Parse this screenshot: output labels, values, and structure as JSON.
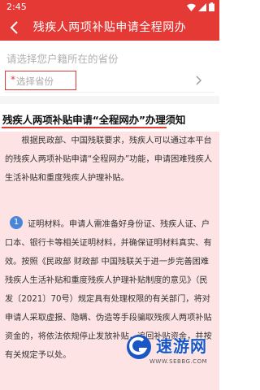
{
  "status": {
    "time": "2:45"
  },
  "header": {
    "title": "残疾人两项补贴申请全程网办"
  },
  "form": {
    "hint": "请选择您户籍所在的省份",
    "required_mark": "*",
    "province_placeholder": "选择省份"
  },
  "notice": {
    "title": "残疾人两项补贴申请“全程网办”办理须知",
    "intro": "根据民政部、中国残联要求，残疾人可以通过本平台的残疾人两项补贴申请“全程网办”功能，申请困难残疾人生活补贴和重度残疾人护理补贴。",
    "item_number": "1",
    "item_text": "证明材料。申请人需准备好身份证、残疾人证、户口本、银行卡等相关证明材料，并确保证明材料真实、有效。按照《民政部 财政部 中国残联关于进一步完善困难残疾人生活补贴和重度残疾人护理补贴制度的意见》（民发〔2021〕70号）规定具有处理权限的有关部门，将对申请人采取虚报、隐瞒、伪造等手段骗取残疾人两项补贴资金的，将依法依规停止发放补贴，追回补贴资金，并按有关规定予以处。"
  },
  "watermark": {
    "name": "速游网",
    "url": "WWW.SEBBG.COM"
  },
  "colors": {
    "brand": "#e53935",
    "notice_bg": "#fde3e3",
    "badge": "#4a86d8"
  }
}
